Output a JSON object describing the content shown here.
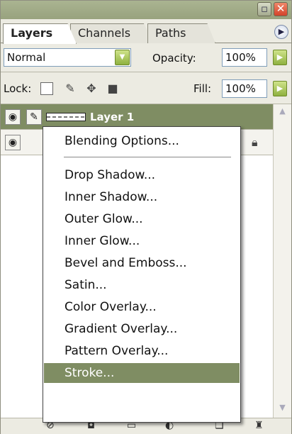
{
  "tabs": [
    {
      "label": "Layers",
      "active": true
    },
    {
      "label": "Channels",
      "active": false
    },
    {
      "label": "Paths",
      "active": false
    }
  ],
  "toolbar": {
    "blend_mode": "Normal",
    "opacity_label": "Opacity:",
    "opacity_value": "100%",
    "lock_label": "Lock:",
    "fill_label": "Fill:",
    "fill_value": "100%"
  },
  "layers": [
    {
      "name": "Layer 1",
      "selected": true
    }
  ],
  "context_menu": {
    "items": [
      "Blending Options...",
      "Drop Shadow...",
      "Inner Shadow...",
      "Outer Glow...",
      "Inner Glow...",
      "Bevel and Emboss...",
      "Satin...",
      "Color Overlay...",
      "Gradient Overlay...",
      "Pattern Overlay...",
      "Stroke..."
    ],
    "highlighted": "Stroke..."
  },
  "colors": {
    "titlebar": "#a3ad88",
    "selected_layer": "#7f8d63",
    "menu_highlight": "#7f8d63",
    "panel_bg": "#ecebe2"
  }
}
